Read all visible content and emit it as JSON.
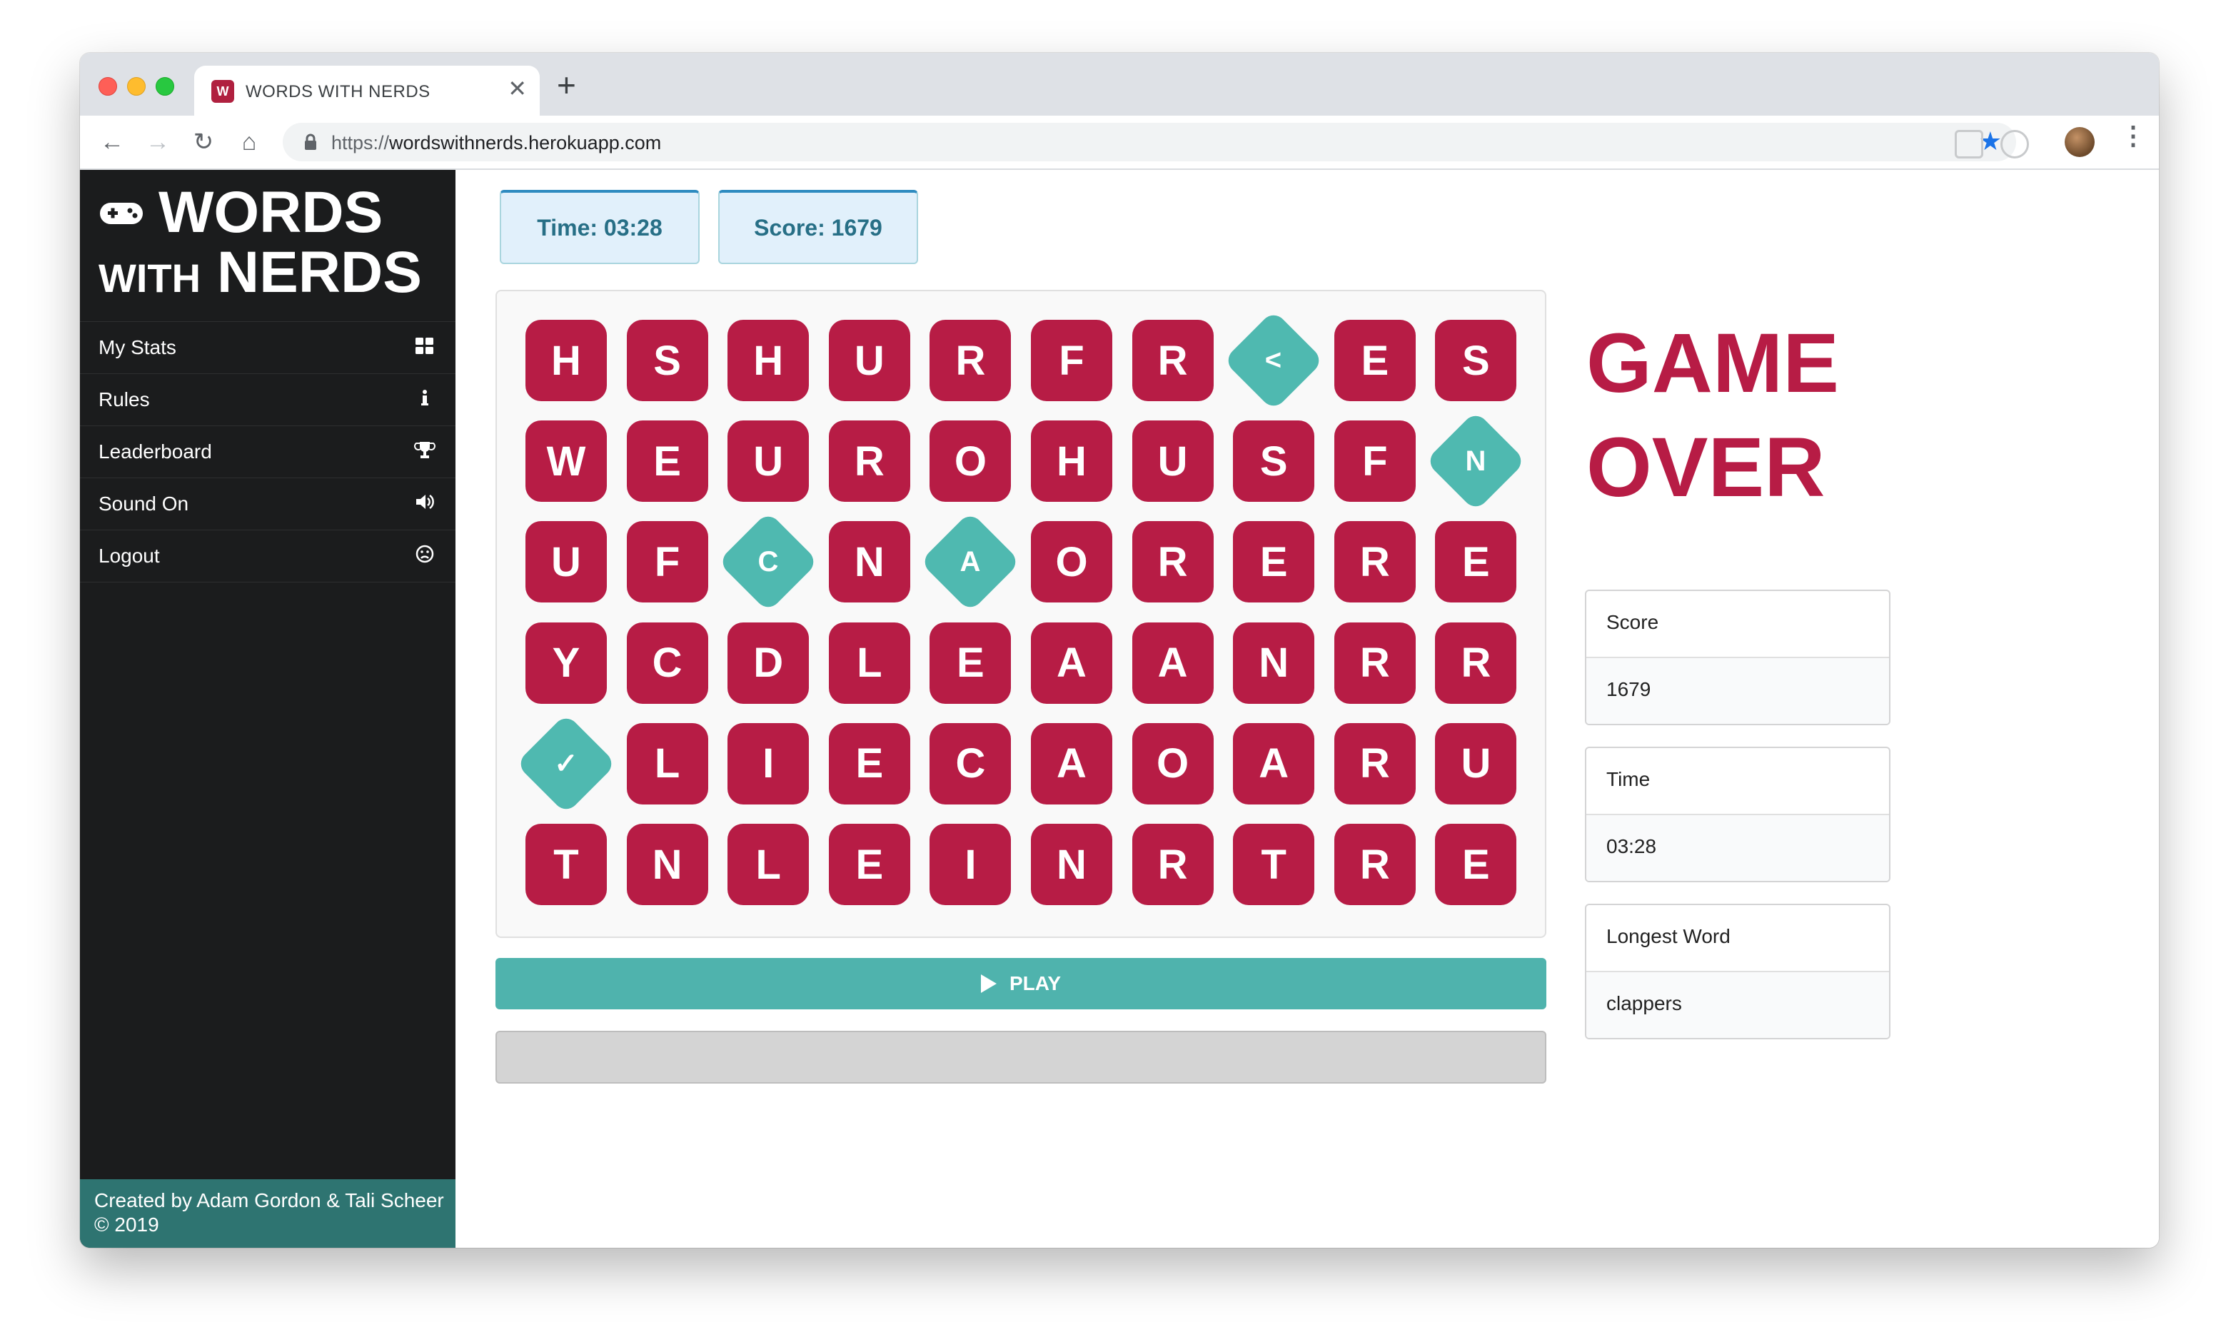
{
  "browser": {
    "tab_title": "WORDS WITH NERDS",
    "favicon_letter": "W",
    "new_tab_symbol": "+",
    "close_symbol": "✕",
    "url_scheme": "https://",
    "url_host": "wordswithnerds.herokuapp.com"
  },
  "sidebar": {
    "brand_line1": "WORDS",
    "brand_with": "WITH",
    "brand_nerds": "NERDS",
    "items": [
      {
        "label": "My Stats",
        "icon": "grid-icon"
      },
      {
        "label": "Rules",
        "icon": "info-icon"
      },
      {
        "label": "Leaderboard",
        "icon": "trophy-icon"
      },
      {
        "label": "Sound On",
        "icon": "volume-icon"
      },
      {
        "label": "Logout",
        "icon": "frown-icon"
      }
    ],
    "footer_line1": "Created by Adam Gordon & Tali Scheer",
    "footer_line2": "© 2019"
  },
  "stats": {
    "time_label": "Time: 03:28",
    "score_label": "Score: 1679"
  },
  "board": {
    "rows": [
      [
        "H",
        "S",
        "H",
        "U",
        "R",
        "F",
        "R",
        "<",
        "E",
        "S"
      ],
      [
        "W",
        "E",
        "U",
        "R",
        "O",
        "H",
        "U",
        "S",
        "F",
        "N"
      ],
      [
        "U",
        "F",
        "C",
        "N",
        "A",
        "O",
        "R",
        "E",
        "R",
        "E"
      ],
      [
        "Y",
        "C",
        "D",
        "L",
        "E",
        "A",
        "A",
        "N",
        "R",
        "R"
      ],
      [
        "✓",
        "L",
        "I",
        "E",
        "C",
        "A",
        "O",
        "A",
        "R",
        "U"
      ],
      [
        "T",
        "N",
        "L",
        "E",
        "I",
        "N",
        "R",
        "T",
        "R",
        "E"
      ]
    ],
    "rotated_tiles": [
      "0-7",
      "1-9",
      "2-2",
      "2-4",
      "4-0"
    ],
    "tile_color": "#b71c45",
    "rotated_color": "#4fb9b0"
  },
  "play_button": {
    "label": "PLAY"
  },
  "result": {
    "title_line1": "GAME",
    "title_line2": "OVER",
    "cards": [
      {
        "label": "Score",
        "value": "1679"
      },
      {
        "label": "Time",
        "value": "03:28"
      },
      {
        "label": "Longest Word",
        "value": "clappers"
      }
    ]
  }
}
